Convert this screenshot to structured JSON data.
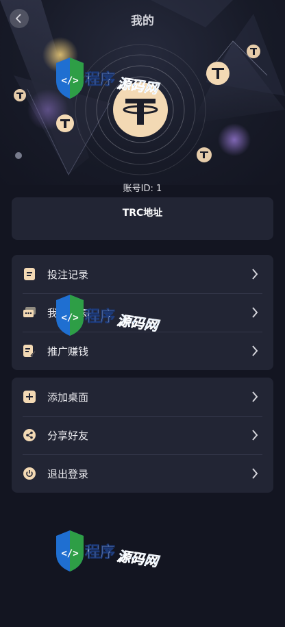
{
  "header": {
    "title": "我的"
  },
  "account": {
    "id_text": "账号ID: 1"
  },
  "trc": {
    "title": "TRC地址",
    "address": ""
  },
  "menu_group_1": [
    {
      "label": "投注记录",
      "icon": "document-icon"
    },
    {
      "label": "我的报表",
      "icon": "cards-icon"
    },
    {
      "label": "推广赚钱",
      "icon": "edit-note-icon"
    }
  ],
  "menu_group_2": [
    {
      "label": "添加桌面",
      "icon": "plus-square-icon"
    },
    {
      "label": "分享好友",
      "icon": "share-icon"
    },
    {
      "label": "退出登录",
      "icon": "power-icon"
    }
  ],
  "watermark": {
    "text": "程序源码网"
  },
  "colors": {
    "background": "#131521",
    "card": "#222534",
    "accent": "#f3d9b4",
    "text": "#ececf0"
  }
}
